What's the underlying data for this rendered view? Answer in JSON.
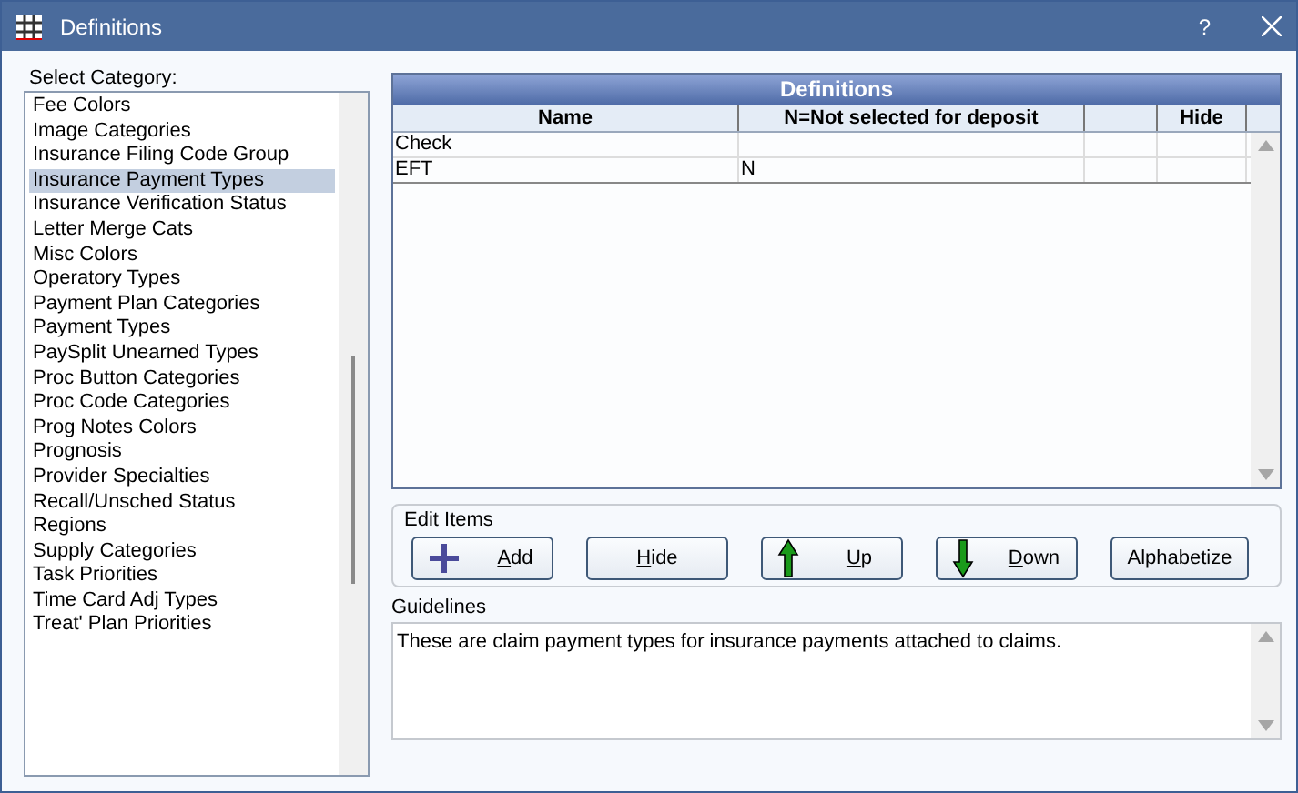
{
  "window": {
    "title": "Definitions",
    "help": "?"
  },
  "category": {
    "label": "Select Category:",
    "items": [
      {
        "label": "Fee Colors",
        "selected": false
      },
      {
        "label": "Image Categories",
        "selected": false
      },
      {
        "label": "Insurance Filing Code Group",
        "selected": false
      },
      {
        "label": "Insurance Payment Types",
        "selected": true
      },
      {
        "label": "Insurance Verification Status",
        "selected": false
      },
      {
        "label": "Letter Merge Cats",
        "selected": false
      },
      {
        "label": "Misc Colors",
        "selected": false
      },
      {
        "label": "Operatory Types",
        "selected": false
      },
      {
        "label": "Payment Plan Categories",
        "selected": false
      },
      {
        "label": "Payment Types",
        "selected": false
      },
      {
        "label": "PaySplit Unearned Types",
        "selected": false
      },
      {
        "label": "Proc Button Categories",
        "selected": false
      },
      {
        "label": "Proc Code Categories",
        "selected": false
      },
      {
        "label": "Prog Notes Colors",
        "selected": false
      },
      {
        "label": "Prognosis",
        "selected": false
      },
      {
        "label": "Provider Specialties",
        "selected": false
      },
      {
        "label": "Recall/Unsched Status",
        "selected": false
      },
      {
        "label": "Regions",
        "selected": false
      },
      {
        "label": "Supply Categories",
        "selected": false
      },
      {
        "label": "Task Priorities",
        "selected": false
      },
      {
        "label": "Time Card Adj Types",
        "selected": false
      },
      {
        "label": "Treat' Plan Priorities",
        "selected": false
      }
    ]
  },
  "table": {
    "title": "Definitions",
    "columns": [
      "Name",
      "N=Not selected for deposit",
      "",
      "Hide"
    ],
    "rows": [
      [
        "Check",
        "",
        "",
        ""
      ],
      [
        "EFT",
        "N",
        "",
        ""
      ]
    ]
  },
  "edit_items": {
    "label": "Edit Items",
    "buttons": [
      {
        "label": "Add",
        "kind": "add"
      },
      {
        "label": "Hide",
        "kind": "plain"
      },
      {
        "label": "Up",
        "kind": "up"
      },
      {
        "label": "Down",
        "kind": "down"
      },
      {
        "label": "Alphabetize",
        "kind": "plain-nounderline"
      }
    ]
  },
  "guidelines": {
    "label": "Guidelines",
    "text": "These are claim payment types for insurance payments attached to claims."
  }
}
